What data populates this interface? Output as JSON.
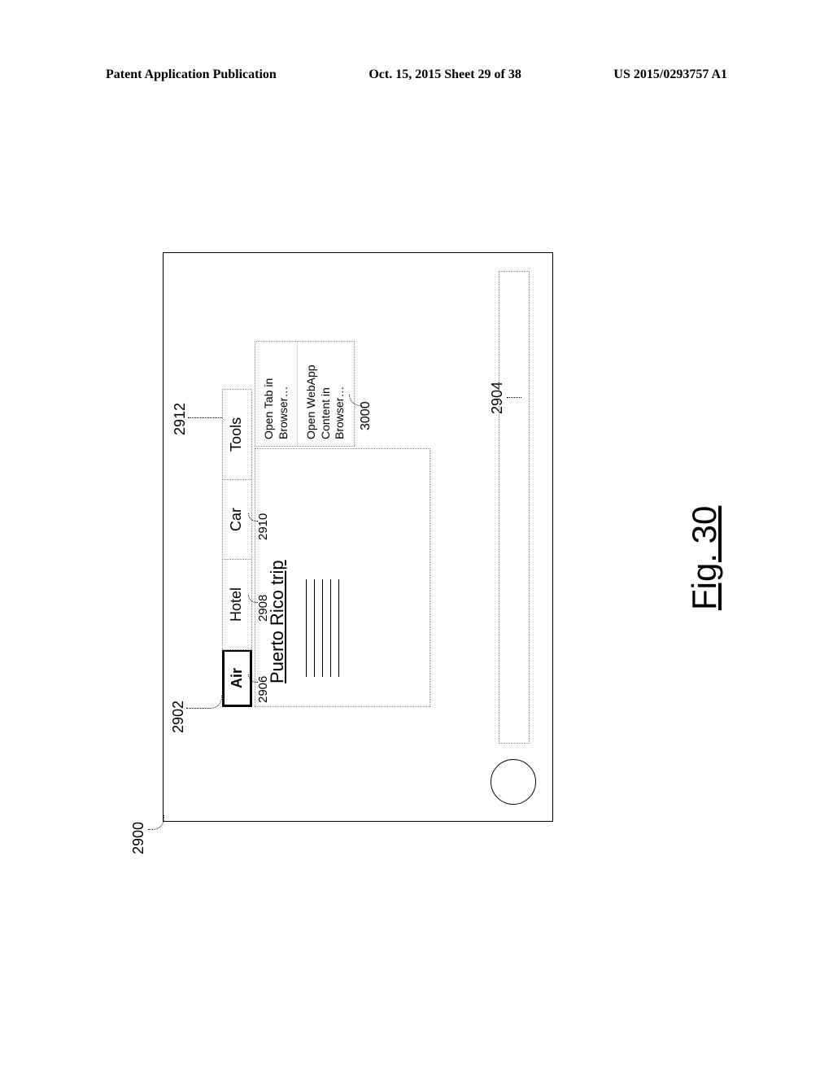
{
  "header": {
    "left": "Patent Application Publication",
    "center": "Oct. 15, 2015  Sheet 29 of 38",
    "right": "US 2015/0293757 A1"
  },
  "figure": {
    "caption": "Fig. 30",
    "device_ref": "2900",
    "toolbar_ref": "2902",
    "bottom_bar_ref": "2904",
    "tab_air_ref": "2906",
    "tab_hotel_ref": "2908",
    "tab_car_ref": "2910",
    "tab_tools_ref": "2912",
    "menu_ref": "3000",
    "tabs": {
      "air": "Air",
      "hotel": "Hotel",
      "car": "Car",
      "tools": "Tools"
    },
    "content_title": "Puerto Rico trip",
    "tools_menu": {
      "open_tab": "Open Tab in Browser…",
      "open_webapp": "Open WebApp Content in Browser…"
    }
  }
}
